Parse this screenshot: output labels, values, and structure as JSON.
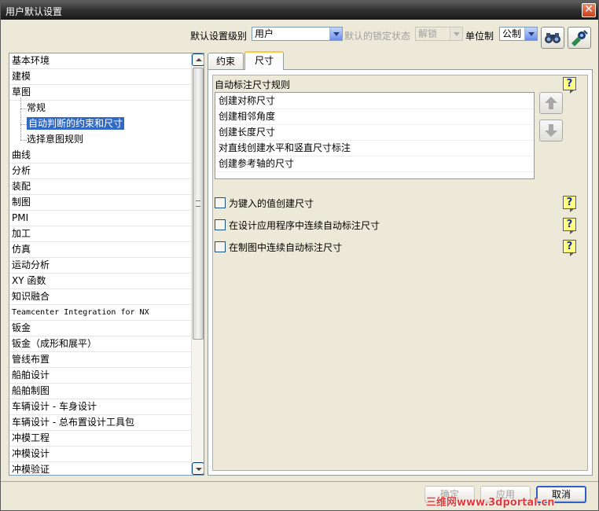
{
  "window": {
    "title": "用户默认设置",
    "close_glyph": "✕"
  },
  "toolbar": {
    "level_label": "默认设置级别",
    "level_value": "用户",
    "lock_label": "默认的锁定状态",
    "lock_value": "解锁",
    "unit_label": "单位制",
    "unit_value": "公制",
    "icons": [
      "find-icon",
      "manage-icon"
    ]
  },
  "tree": {
    "items": [
      {
        "label": "基本环境"
      },
      {
        "label": "建模"
      },
      {
        "label": "草图"
      },
      {
        "label": "常规",
        "indent": 1
      },
      {
        "label": "自动判断的约束和尺寸",
        "indent": 1,
        "selected": true
      },
      {
        "label": "选择意图规则",
        "indent": 1
      },
      {
        "label": "曲线"
      },
      {
        "label": "分析"
      },
      {
        "label": "装配"
      },
      {
        "label": "制图"
      },
      {
        "label": "PMI"
      },
      {
        "label": "加工"
      },
      {
        "label": "仿真"
      },
      {
        "label": "运动分析"
      },
      {
        "label": "XY 函数"
      },
      {
        "label": "知识融合"
      },
      {
        "label": "Teamcenter Integration for NX"
      },
      {
        "label": "钣金"
      },
      {
        "label": "钣金（成形和展平）"
      },
      {
        "label": "管线布置"
      },
      {
        "label": "船舶设计"
      },
      {
        "label": "船舶制图"
      },
      {
        "label": "车辆设计 - 车身设计"
      },
      {
        "label": "车辆设计 - 总布置设计工具包"
      },
      {
        "label": "冲模工程"
      },
      {
        "label": "冲模设计"
      },
      {
        "label": "冲模验证"
      }
    ]
  },
  "tabs": [
    {
      "label": "约束"
    },
    {
      "label": "尺寸",
      "active": true
    }
  ],
  "dimensions_tab": {
    "rules_title": "自动标注尺寸规则",
    "rules": [
      "创建对称尺寸",
      "创建相邻角度",
      "创建长度尺寸",
      "对直线创建水平和竖直尺寸标注",
      "创建参考轴的尺寸"
    ],
    "options": [
      {
        "label": "为键入的值创建尺寸",
        "checked": false
      },
      {
        "label": "在设计应用程序中连续自动标注尺寸",
        "checked": false
      },
      {
        "label": "在制图中连续自动标注尺寸",
        "checked": false
      }
    ],
    "help_glyph": "?"
  },
  "buttons": {
    "ok": "确定",
    "apply": "应用",
    "cancel": "取消"
  },
  "watermark": "三维网www.3dportal.cn"
}
